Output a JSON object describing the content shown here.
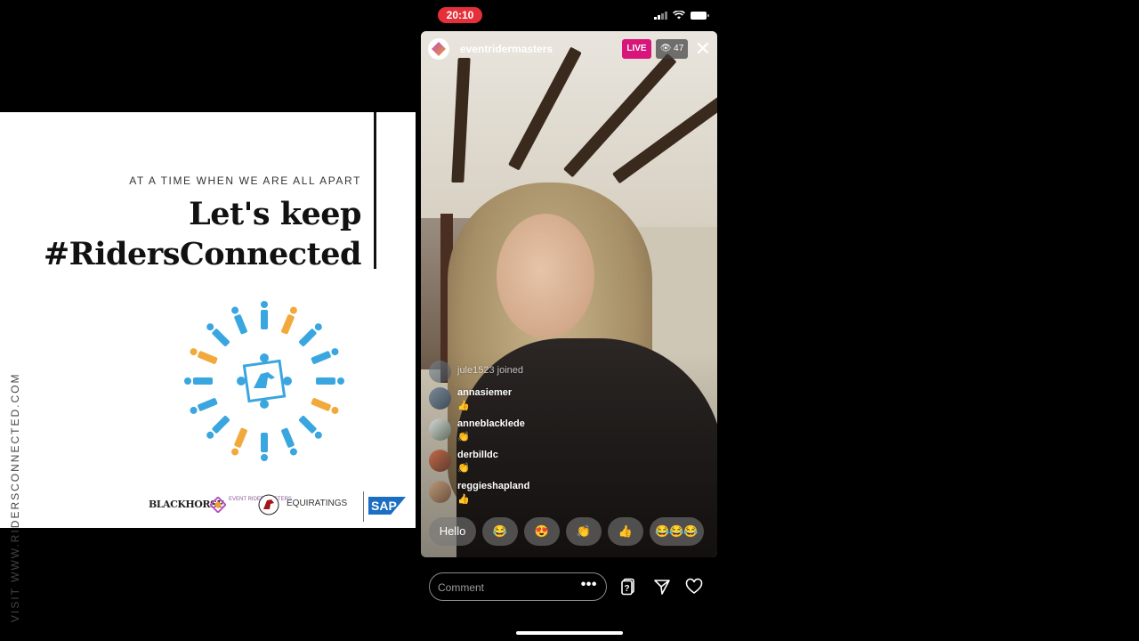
{
  "status_bar": {
    "time": "20:10"
  },
  "promo": {
    "kicker": "AT A TIME WHEN WE ARE ALL APART",
    "headline_line1": "Let's keep",
    "headline_line2": "#RidersConnected",
    "visit": "VISIT WWW.RIDERSCONNECTED.COM",
    "sponsors": [
      "BLACKHORSE",
      "EVENT RIDER MASTERS",
      "EQUIRATINGS",
      "SAP"
    ]
  },
  "live": {
    "account": "eventridermasters",
    "badge": "LIVE",
    "viewer_count": "47",
    "comments": [
      {
        "user": "jule1523 joined",
        "message": "",
        "type": "join"
      },
      {
        "user": "annasiemer",
        "message": "👍"
      },
      {
        "user": "anneblacklede",
        "message": "👏"
      },
      {
        "user": "derbilldc",
        "message": "👏"
      },
      {
        "user": "reggieshapland",
        "message": "👍"
      }
    ],
    "quick_replies": [
      "Hello",
      "😂",
      "😍",
      "👏",
      "👍",
      "😂😂😂"
    ]
  },
  "comment_bar": {
    "placeholder": "Comment",
    "more": "•••"
  },
  "colors": {
    "live_badge": "#d7157a",
    "time_pill": "#e5303a",
    "accent_blue": "#3aa6e0",
    "accent_orange": "#f2a93b"
  }
}
